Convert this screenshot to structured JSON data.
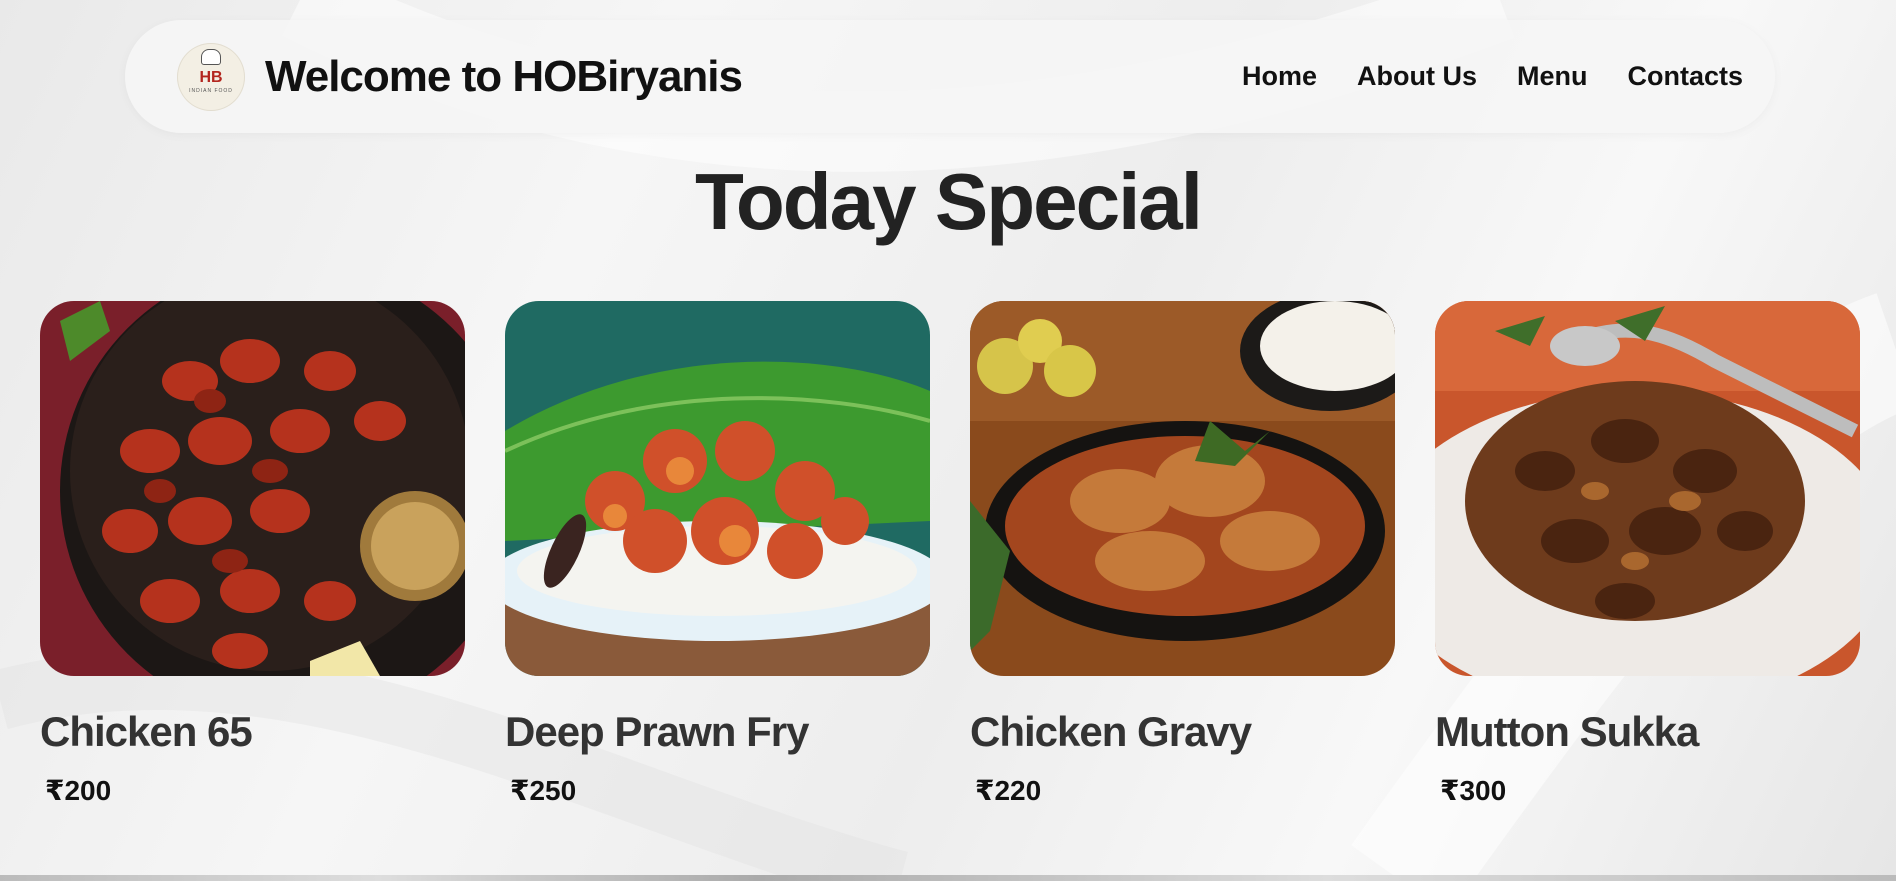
{
  "header": {
    "logo_mark": "HB",
    "logo_subtitle": "INDIAN FOOD",
    "title": "Welcome to HOBiryanis",
    "nav": [
      {
        "label": "Home"
      },
      {
        "label": "About Us"
      },
      {
        "label": "Menu"
      },
      {
        "label": "Contacts"
      }
    ]
  },
  "section": {
    "title": "Today Special"
  },
  "items": [
    {
      "name": "Chicken 65",
      "price": "₹200",
      "image": "chicken-65-photo"
    },
    {
      "name": "Deep Prawn Fry",
      "price": "₹250",
      "image": "prawn-fry-photo"
    },
    {
      "name": "Chicken Gravy",
      "price": "₹220",
      "image": "chicken-gravy-photo"
    },
    {
      "name": "Mutton Sukka",
      "price": "₹300",
      "image": "mutton-sukka-photo"
    }
  ]
}
